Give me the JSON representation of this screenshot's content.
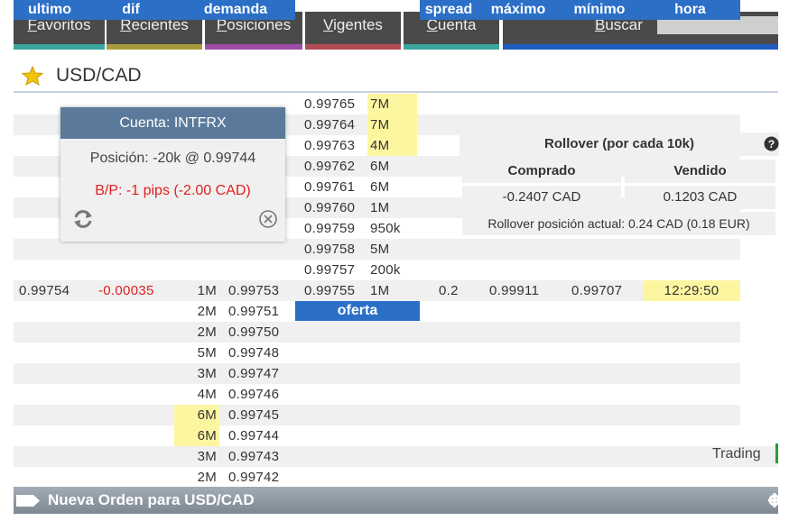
{
  "nav": {
    "tabs": [
      {
        "label_u": "F",
        "label_rest": "avoritos",
        "color": "#3aa6a0"
      },
      {
        "label_u": "R",
        "label_rest": "ecientes",
        "color": "#a89a3a"
      },
      {
        "label_u": "P",
        "label_rest": "osiciones",
        "color": "#a04da8"
      },
      {
        "label_u": "V",
        "label_rest": "igentes",
        "color": "#b44a52"
      },
      {
        "label_u": "C",
        "label_rest": "uenta",
        "color": "#3aa6a0"
      }
    ],
    "search_u": "B",
    "search_rest": "uscar",
    "search_color": "#1f5bc0"
  },
  "title": "USD/CAD",
  "popup": {
    "header": "Cuenta: INTFRX",
    "position": "Posición: -20k @ 0.99744",
    "pl": "B/P: -1 pips (-2.00 CAD)"
  },
  "rollover": {
    "title": "Rollover (por cada 10k)",
    "bought_label": "Comprado",
    "sold_label": "Vendido",
    "bought_value": "-0.2407 CAD",
    "sold_value": "0.1203 CAD",
    "current": "Rollover posición actual: 0.24 CAD (0.18 EUR)"
  },
  "offers": [
    {
      "price": "0.99765",
      "size": "7M",
      "hl": true
    },
    {
      "price": "0.99764",
      "size": "7M",
      "hl": true
    },
    {
      "price": "0.99763",
      "size": "4M",
      "hl": true
    },
    {
      "price": "0.99762",
      "size": "6M",
      "hl": false
    },
    {
      "price": "0.99761",
      "size": "6M",
      "hl": false
    },
    {
      "price": "0.99760",
      "size": "1M",
      "hl": false
    },
    {
      "price": "0.99759",
      "size": "950k",
      "hl": false
    },
    {
      "price": "0.99758",
      "size": "5M",
      "hl": false
    },
    {
      "price": "0.99757",
      "size": "200k",
      "hl": false
    },
    {
      "price": "0.99755",
      "size": "1M",
      "hl": false
    }
  ],
  "headers": {
    "ultimo": "ultimo",
    "dif": "dif",
    "demanda": "demanda",
    "oferta": "oferta",
    "spread": "spread",
    "maximo": "máximo",
    "minimo": "mínimo",
    "hora": "hora"
  },
  "quote": {
    "ultimo": "0.99754",
    "dif": "-0.00035",
    "spread": "0.2",
    "maximo": "0.99911",
    "minimo": "0.99707",
    "hora": "12:29:50"
  },
  "bids": [
    {
      "size": "1M",
      "price": "0.99753",
      "hl": false
    },
    {
      "size": "2M",
      "price": "0.99751",
      "hl": false
    },
    {
      "size": "2M",
      "price": "0.99750",
      "hl": false
    },
    {
      "size": "5M",
      "price": "0.99748",
      "hl": false
    },
    {
      "size": "3M",
      "price": "0.99747",
      "hl": false
    },
    {
      "size": "4M",
      "price": "0.99746",
      "hl": false
    },
    {
      "size": "6M",
      "price": "0.99745",
      "hl": true
    },
    {
      "size": "6M",
      "price": "0.99744",
      "hl": true
    },
    {
      "size": "3M",
      "price": "0.99743",
      "hl": false
    },
    {
      "size": "2M",
      "price": "0.99742",
      "hl": false
    }
  ],
  "trading_label": "Trading",
  "new_order": "Nueva Orden para USD/CAD",
  "colors": {
    "accent": "#2b6fc7",
    "loss": "#e02020",
    "highlight": "#fdf6a0"
  }
}
